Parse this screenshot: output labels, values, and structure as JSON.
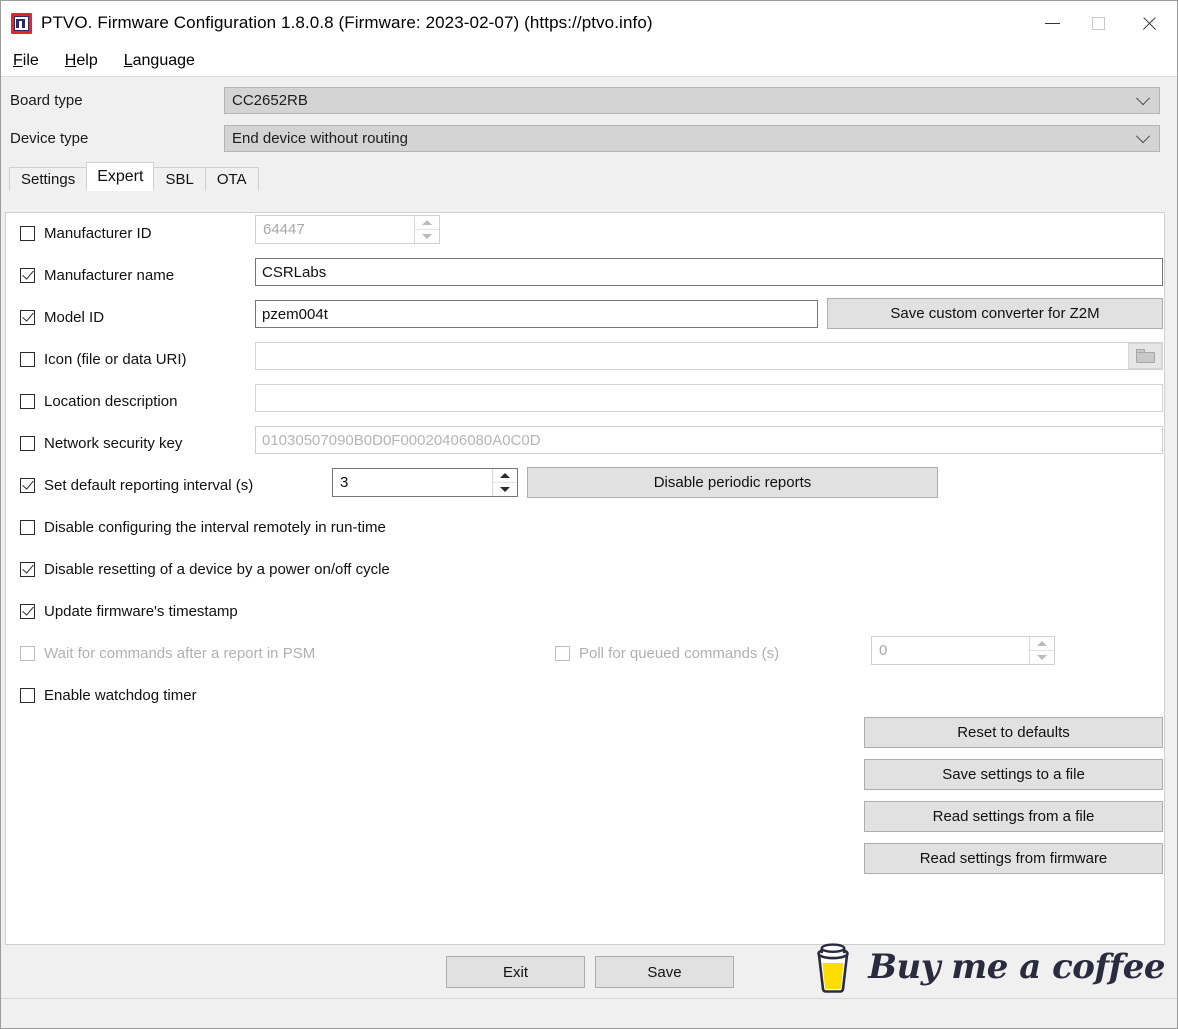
{
  "window": {
    "title": "PTVO. Firmware Configuration 1.8.0.8 (Firmware: 2023-02-07) (https://ptvo.info)",
    "app_icon": "ptvo-app-icon",
    "minimize_label": "Minimize",
    "maximize_label": "Maximize",
    "close_label": "Close"
  },
  "menubar": {
    "items": [
      {
        "label": "File",
        "accelerator": "F",
        "rest": "ile"
      },
      {
        "label": "Help",
        "accelerator": "H",
        "rest": "elp"
      },
      {
        "label": "Language",
        "accelerator": "L",
        "rest": "anguage"
      }
    ]
  },
  "top_fields": {
    "board_type": {
      "label": "Board type",
      "value": "CC2652RB"
    },
    "device_type": {
      "label": "Device type",
      "value": "End device without routing"
    }
  },
  "tabs": [
    {
      "label": "Settings",
      "active": false
    },
    {
      "label": "Expert",
      "active": true
    },
    {
      "label": "SBL",
      "active": false
    },
    {
      "label": "OTA",
      "active": false
    }
  ],
  "expert": {
    "manufacturer_id": {
      "label": "Manufacturer ID",
      "checked": false,
      "value": "64447",
      "enabled": false
    },
    "manufacturer_name": {
      "label": "Manufacturer name",
      "checked": true,
      "value": "CSRLabs"
    },
    "model_id": {
      "label": "Model ID",
      "checked": true,
      "value": "pzem004t"
    },
    "save_converter_button": "Save custom converter for Z2M",
    "icon_uri": {
      "label": "Icon (file or data URI)",
      "checked": false,
      "value": "",
      "browse_icon": "folder-open-icon"
    },
    "location_description": {
      "label": "Location description",
      "checked": false,
      "value": ""
    },
    "network_security_key": {
      "label": "Network security key",
      "checked": false,
      "value": "01030507090B0D0F00020406080A0C0D"
    },
    "reporting_interval": {
      "label": "Set default reporting interval (s)",
      "checked": true,
      "value": "3"
    },
    "disable_periodic_button": "Disable periodic reports",
    "disable_configuring_interval": {
      "label": "Disable configuring the interval remotely in run-time",
      "checked": false
    },
    "disable_resetting": {
      "label": "Disable resetting of a device by a power on/off cycle",
      "checked": true
    },
    "update_timestamp": {
      "label": "Update firmware's timestamp",
      "checked": true
    },
    "wait_for_commands": {
      "label": "Wait for commands after a report in PSM",
      "checked": false,
      "enabled": false
    },
    "poll_queued_commands": {
      "label": "Poll for queued commands (s)",
      "checked": false,
      "enabled": false,
      "value": "0"
    },
    "enable_watchdog": {
      "label": "Enable watchdog timer",
      "checked": false
    },
    "side_buttons": [
      "Reset to defaults",
      "Save settings to a file",
      "Read settings from a file",
      "Read settings from firmware"
    ]
  },
  "footer": {
    "exit_button": "Exit",
    "save_button": "Save",
    "coffee_text": "Buy me a coffee",
    "coffee_icon": "coffee-cup-icon"
  },
  "colors": {
    "window_bg": "#f0f0f0",
    "page_bg": "#ffffff",
    "button_bg": "#e1e1e1",
    "accent_red": "#e8232a",
    "coffee_yellow": "#ffdd00",
    "coffee_dark": "#2b2b40"
  }
}
